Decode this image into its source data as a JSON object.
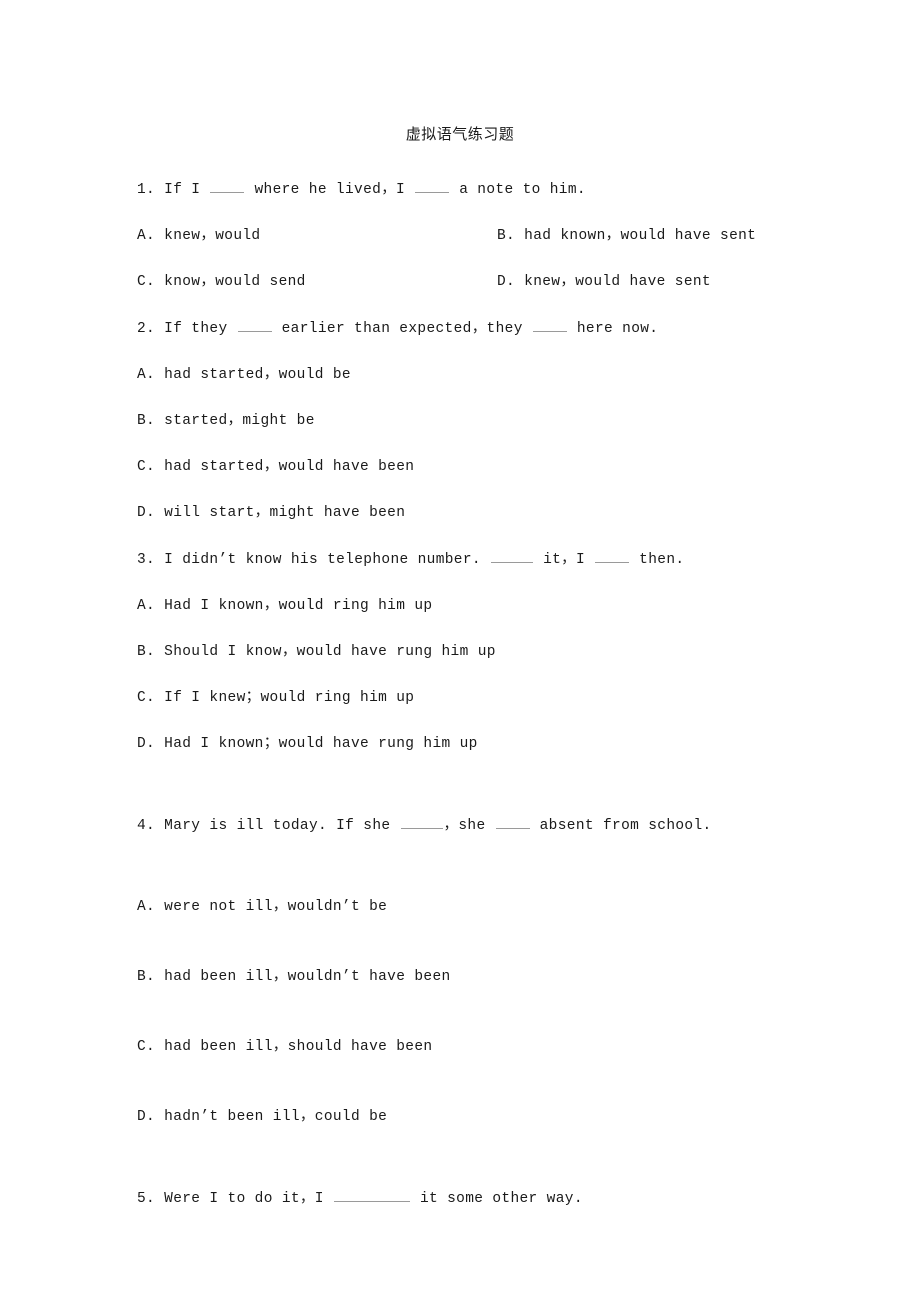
{
  "document": {
    "title": "虚拟语气练习题"
  },
  "questions": [
    {
      "id": "q1",
      "stem_part1": "1. If I ",
      "stem_part2": " where he lived，I ",
      "stem_part3": " a note to him.",
      "layout": "two-column",
      "options": [
        {
          "key": "A",
          "text": "A. knew，would"
        },
        {
          "key": "B",
          "text": "B. had known，would have sent"
        },
        {
          "key": "C",
          "text": "C. know，would send"
        },
        {
          "key": "D",
          "text": "D. knew，would have sent"
        }
      ]
    },
    {
      "id": "q2",
      "stem_part1": "2. If they ",
      "stem_part2": " earlier than expected，they ",
      "stem_part3": " here now.",
      "layout": "single-column",
      "options": [
        {
          "key": "A",
          "text": "A. had started，would be"
        },
        {
          "key": "B",
          "text": "B. started，might be"
        },
        {
          "key": "C",
          "text": "C. had started，would have been"
        },
        {
          "key": "D",
          "text": "D. will start，might have been"
        }
      ]
    },
    {
      "id": "q3",
      "stem_part1": "3. I didn’t know his telephone number. ",
      "stem_part2": " it，I ",
      "stem_part3": " then.",
      "layout": "single-column",
      "options": [
        {
          "key": "A",
          "text": "A. Had I known，would ring him up"
        },
        {
          "key": "B",
          "text": "B. Should I know，would have rung him up"
        },
        {
          "key": "C",
          "text": "C. If I knew；would ring him up"
        },
        {
          "key": "D",
          "text": "D. Had I known；would have rung him up"
        }
      ]
    },
    {
      "id": "q4",
      "stem_part1": "4. Mary is ill today. If she ",
      "stem_part2": "，she ",
      "stem_part3": " absent from school.",
      "layout": "single-column-wide",
      "options": [
        {
          "key": "A",
          "text": "A. were not ill，wouldn’t be"
        },
        {
          "key": "B",
          "text": "B. had been ill，wouldn’t have been"
        },
        {
          "key": "C",
          "text": "C. had been ill，should have been"
        },
        {
          "key": "D",
          "text": "D. hadn’t been ill，could be"
        }
      ]
    },
    {
      "id": "q5",
      "stem_part1": "5. Were I to do it，I ",
      "stem_part2": " it some other way.",
      "layout": "stem-only",
      "options": []
    }
  ]
}
